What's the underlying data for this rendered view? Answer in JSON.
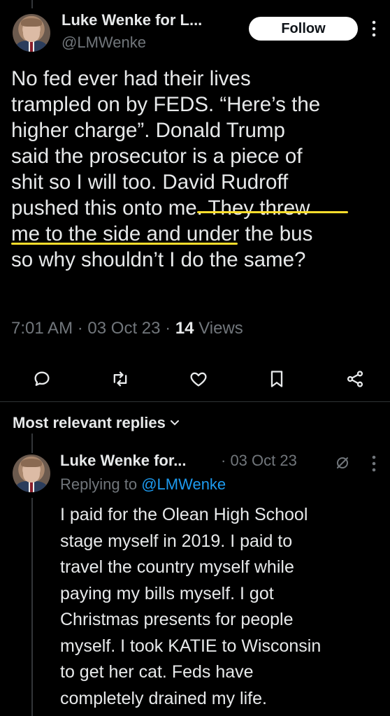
{
  "tweet": {
    "author_name": "Luke Wenke for L...",
    "author_handle": "@LMWenke",
    "follow_label": "Follow",
    "lines": [
      "No fed ever had their lives",
      "trampled on by FEDS.  “Here’s the",
      "higher charge”.  Donald Trump",
      "said the prosecutor is a piece of",
      "shit so I will too.  David Rudroff",
      "pushed this onto me.  They threw",
      "me to the side and under the bus",
      "so why shouldn’t I do the same?"
    ],
    "time": "7:01 AM",
    "date": "03 Oct 23",
    "views_count": "14",
    "views_label": "Views",
    "sep": "·"
  },
  "actions": [
    {
      "name": "reply-icon"
    },
    {
      "name": "retweet-icon"
    },
    {
      "name": "like-icon"
    },
    {
      "name": "bookmark-icon"
    },
    {
      "name": "share-icon"
    }
  ],
  "replies_header": "Most relevant replies",
  "reply": {
    "author_name": "Luke Wenke for...",
    "date": "· 03 Oct 23",
    "replying_prefix": "Replying to",
    "replying_to": "@LMWenke",
    "lines": [
      "I paid for the Olean High School",
      "stage myself in 2019.  I paid to",
      "travel the country myself while",
      "paying my bills myself.  I got",
      "Christmas presents for people",
      "myself.  I took KATIE to Wisconsin",
      "to get her cat.  Feds have",
      "completely drained my life."
    ]
  },
  "colors": {
    "background": "#000000",
    "text": "#e7e9ea",
    "muted": "#71767b",
    "link": "#1d9bf0",
    "highlight_underline": "#ffde2c"
  }
}
